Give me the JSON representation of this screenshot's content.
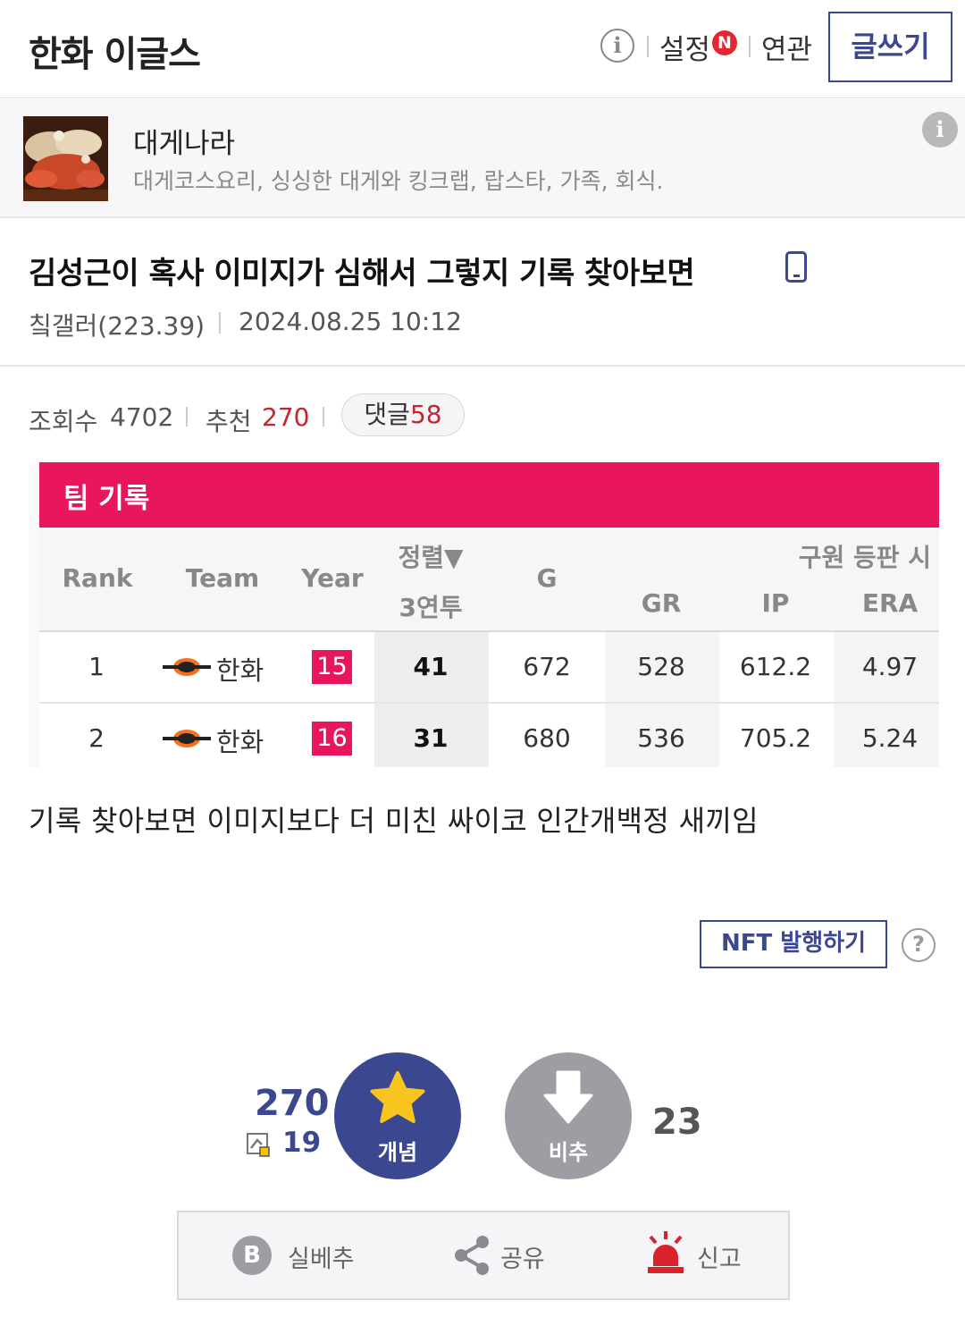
{
  "header": {
    "gallery_title": "한화 이글스",
    "settings_label": "설정",
    "settings_badge": "N",
    "related_label": "연관",
    "write_label": "글쓰기",
    "info_icon": "info-icon"
  },
  "ad": {
    "name": "대게나라",
    "description": "대게코스요리, 싱싱한 대게와 킹크랩, 랍스타, 가족, 회식.",
    "info_icon": "info-icon"
  },
  "post": {
    "title": "김성근이 혹사 이미지가 심해서 그렇지 기록 찾아보면",
    "device_icon": "mobile-phone-icon",
    "author": "칰갤러(223.39)",
    "date": "2024.08.25 10:12",
    "views_label": "조회수",
    "views": "4702",
    "recommend_label": "추천",
    "recommend": "270",
    "comment_label": "댓글",
    "comments": "58",
    "body": "기록 찾아보면 이미지보다 더 미친 싸이코 인간개백정 새끼임"
  },
  "record_table": {
    "title": "팀 기록",
    "header_group": "구원 등판 시",
    "sort_label": "정렬▼",
    "columns": [
      "Rank",
      "Team",
      "Year",
      "3연투",
      "G",
      "GR",
      "IP",
      "ERA"
    ],
    "rows": [
      {
        "rank": "1",
        "team": "한화",
        "year": "15",
        "three_straight": "41",
        "g": "672",
        "gr": "528",
        "ip": "612.2",
        "era": "4.97"
      },
      {
        "rank": "2",
        "team": "한화",
        "year": "16",
        "three_straight": "31",
        "g": "680",
        "gr": "536",
        "ip": "705.2",
        "era": "5.24"
      }
    ],
    "accent_color": "#e8175d"
  },
  "nft": {
    "button_label": "NFT 발행하기",
    "help_label": "?"
  },
  "votes": {
    "up_count": "270",
    "fixed_count": "19",
    "up_label": "개념",
    "down_label": "비추",
    "down_count": "23",
    "up_icon": "star-icon",
    "down_icon": "arrow-down-icon"
  },
  "actions": {
    "best_label": "실베추",
    "share_label": "공유",
    "report_label": "신고"
  },
  "colors": {
    "brand": "#3b4890",
    "accent": "#e8175d",
    "badge_red": "#e3262f"
  }
}
